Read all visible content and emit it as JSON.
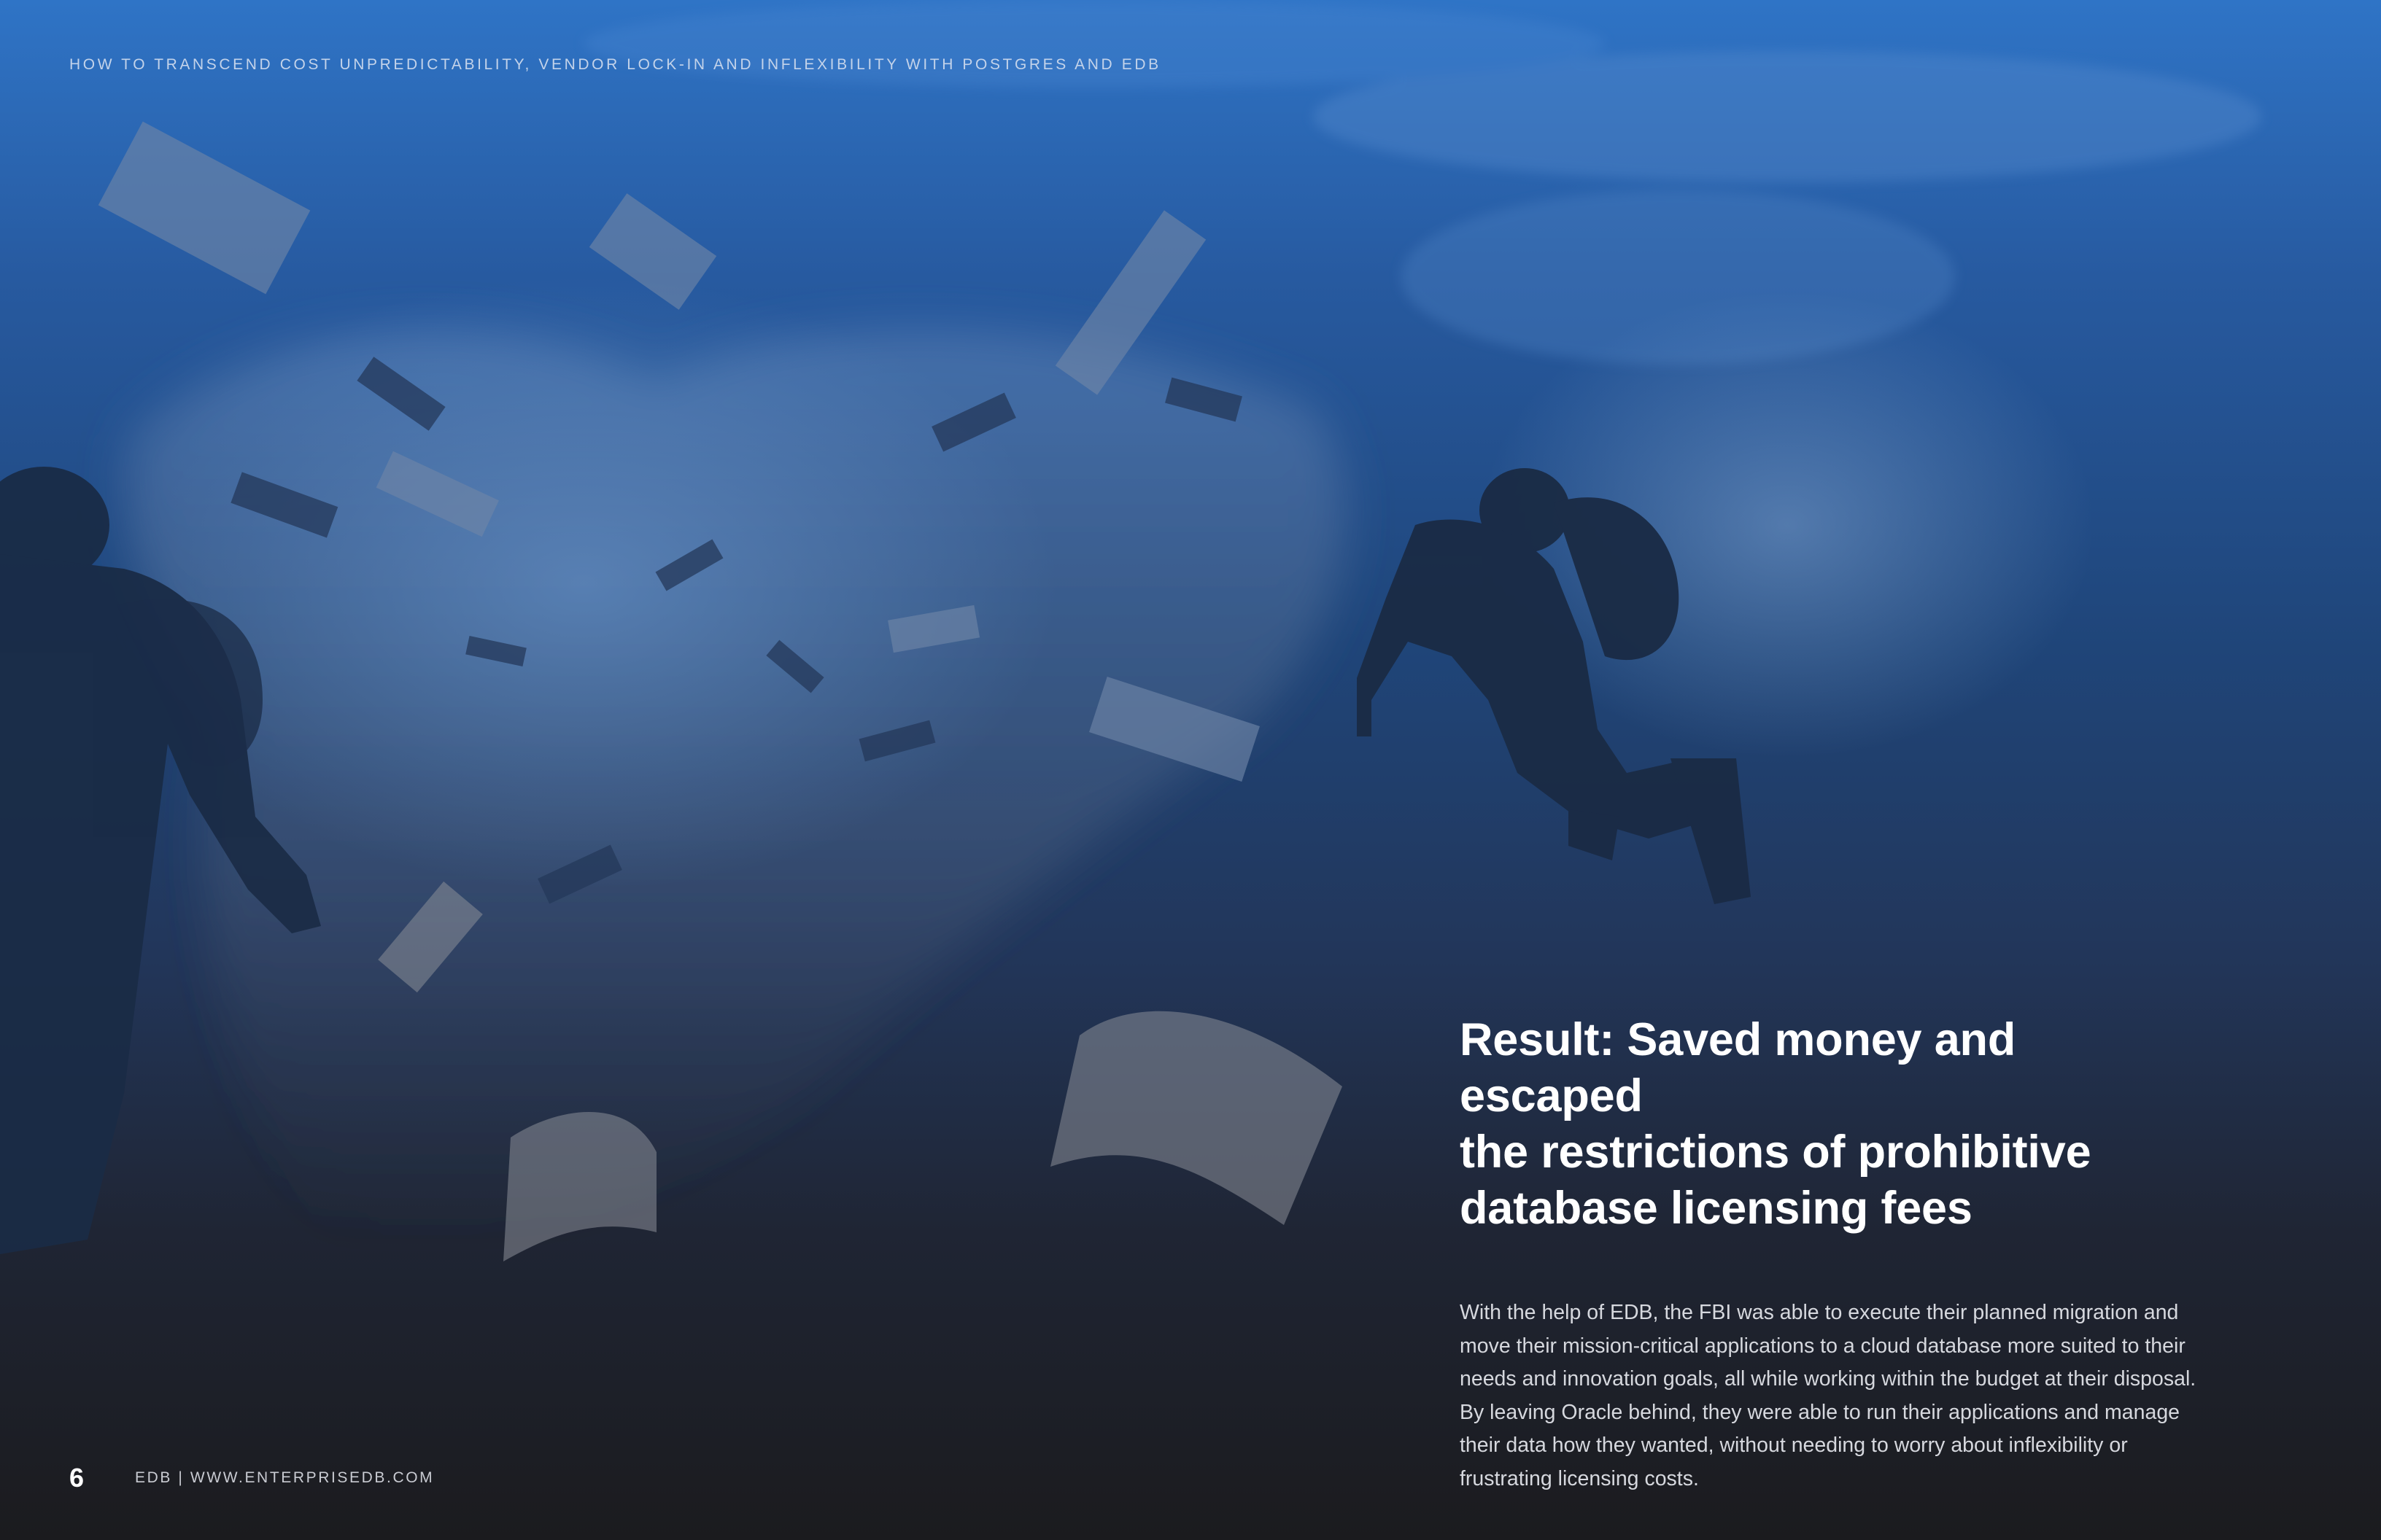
{
  "header": {
    "running_title": "HOW TO TRANSCEND COST UNPREDICTABILITY, VENDOR LOCK-IN AND INFLEXIBILITY WITH POSTGRES AND EDB"
  },
  "result": {
    "headline_lines": [
      "Result: Saved money and escaped",
      "the restrictions of prohibitive",
      "database licensing fees"
    ],
    "body_lines": [
      "With the help of EDB, the FBI was able to execute their planned migration and",
      "move their mission-critical applications to a cloud database more suited to their",
      "needs and innovation goals, all while working within the budget at their disposal.",
      "By leaving Oracle behind, they were able to run their applications and manage",
      "their data how they wanted, without needing to worry about inflexibility or",
      "frustrating licensing costs."
    ]
  },
  "footer": {
    "page_number": "6",
    "site": "EDB | WWW.ENTERPRISEDB.COM"
  },
  "colors": {
    "ocean_top": "#2f74c6",
    "ocean_mid": "#1f4579",
    "page_bottom": "#1b1b1e",
    "diver_silhouette": "#1a2b45",
    "headline": "#ffffff",
    "body_text": "#d6d8de"
  }
}
